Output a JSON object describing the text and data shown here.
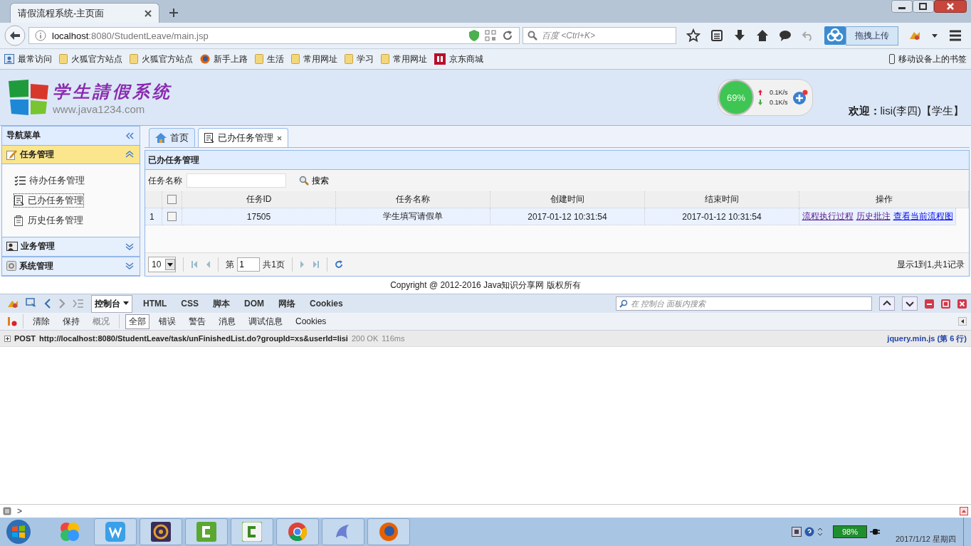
{
  "browser": {
    "tab_title": "请假流程系统-主页面",
    "address_host": "localhost",
    "address_rest": ":8080/StudentLeave/main.jsp",
    "search_placeholder": "百度 <Ctrl+K>",
    "upload_popup": "拖拽上传",
    "bookmarks": [
      {
        "label": "最常访问",
        "kind": "special"
      },
      {
        "label": "火狐官方站点",
        "kind": "folder"
      },
      {
        "label": "火狐官方站点",
        "kind": "folder"
      },
      {
        "label": "新手上路",
        "kind": "firefox"
      },
      {
        "label": "生活",
        "kind": "folder"
      },
      {
        "label": "常用网址",
        "kind": "folder"
      },
      {
        "label": "学习",
        "kind": "folder"
      },
      {
        "label": "常用网址",
        "kind": "folder"
      },
      {
        "label": "京东商城",
        "kind": "jd"
      }
    ],
    "mobile_bookmarks": "移动设备上的书签"
  },
  "header": {
    "title": "学生請假系统",
    "site": "www.java1234.com",
    "meter": "69%",
    "upload_speed": "0.1K/s",
    "download_speed": "0.1K/s",
    "welcome": "**欢迎：**lisi(李四)【学生】"
  },
  "sidebar": {
    "title": "导航菜单",
    "groups": [
      {
        "label": "任务管理",
        "kind": "task",
        "expanded": true,
        "items": [
          {
            "label": "待办任务管理",
            "kind": "todo",
            "selected": false
          },
          {
            "label": "已办任务管理",
            "kind": "done",
            "selected": true
          },
          {
            "label": "历史任务管理",
            "kind": "history",
            "selected": false
          }
        ]
      },
      {
        "label": "业务管理",
        "kind": "business",
        "expanded": false
      },
      {
        "label": "系统管理",
        "kind": "system",
        "expanded": false
      }
    ]
  },
  "tabs": [
    {
      "label": "首页",
      "kind": "home",
      "selected": false,
      "closable": false
    },
    {
      "label": "已办任务管理",
      "kind": "doc",
      "selected": true,
      "closable": true
    }
  ],
  "panel": {
    "title": "已办任务管理",
    "search_label": "任务名称",
    "search_button": "搜索",
    "select_all_checked": false,
    "columns": [
      "任务ID",
      "任务名称",
      "创建时间",
      "结束时间",
      "操作"
    ],
    "rows": [
      {
        "index": "1",
        "checked": false,
        "cells": [
          "17505",
          "学生填写请假单",
          "2017-01-12 10:31:54",
          "2017-01-12 10:31:54"
        ],
        "actions": [
          "流程执行过程",
          "历史批注",
          "查看当前流程图"
        ]
      }
    ],
    "pager": {
      "page_size": "10",
      "before": "第",
      "page": "1",
      "after": "共1页",
      "summary": "显示1到1,共1记录"
    }
  },
  "footer": "Copyright @ 2012-2016 Java知识分享网 版权所有",
  "devtools": {
    "tabs": [
      {
        "label": "控制台",
        "selected": true
      },
      {
        "label": "HTML",
        "selected": false
      },
      {
        "label": "CSS",
        "selected": false
      },
      {
        "label": "脚本",
        "selected": false
      },
      {
        "label": "DOM",
        "selected": false
      },
      {
        "label": "网络",
        "selected": false
      },
      {
        "label": "Cookies",
        "selected": false
      }
    ],
    "search_placeholder": "在 控制台 面板内搜索",
    "actions": [
      {
        "label": "清除",
        "disabled": false
      },
      {
        "label": "保持",
        "disabled": false
      },
      {
        "label": "概况",
        "disabled": true
      }
    ],
    "filters": [
      {
        "label": "全部",
        "selected": true
      },
      {
        "label": "错误",
        "selected": false
      },
      {
        "label": "警告",
        "selected": false
      },
      {
        "label": "消息",
        "selected": false
      },
      {
        "label": "调试信息",
        "selected": false
      },
      {
        "label": "Cookies",
        "selected": false
      }
    ],
    "log": [
      {
        "method": "POST",
        "url": "http://localhost:8080/StudentLeave/task/unFinishedList.do?groupId=xs&userId=lisi",
        "status": "200 OK",
        "time": "116ms",
        "source": "jquery.min.js (第 6 行)"
      }
    ],
    "prompt": ">"
  },
  "taskbar": {
    "apps": [
      {
        "kind": "colors"
      },
      {
        "kind": "w"
      },
      {
        "kind": "ide"
      },
      {
        "kind": "c"
      },
      {
        "kind": "c2"
      },
      {
        "kind": "chrome"
      },
      {
        "kind": "dolphin"
      },
      {
        "kind": "firefox"
      }
    ],
    "battery": "98%",
    "date": "2017/1/12 星期四"
  }
}
